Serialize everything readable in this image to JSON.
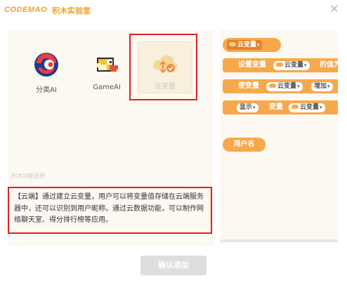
{
  "header": {
    "logo": "CODEMAO",
    "separator": "·",
    "title": "积木实验室",
    "close_icon": "close-icon"
  },
  "extensions": [
    {
      "label": "分类AI",
      "icon": "ai-classifier-icon"
    },
    {
      "label": "GameAI",
      "icon": "flappy-bird-icon"
    },
    {
      "label": "云变量",
      "icon": "cloud-variable-icon",
      "selected": true
    }
  ],
  "panel_hint": "积木功能选择",
  "description": "【云端】通过建立云变量，用户可以将变量值存储在云端服务器中，还可以识别到用户昵称。通过云数据功能，可以制作网络聊天室、得分排行榜等应用。",
  "blocks": {
    "cloud_var": "云变量",
    "set_label": "设置变量",
    "set_value": "的值为",
    "use_label": "使变量",
    "increase": "增加",
    "show": "显示",
    "variable_label": "变量",
    "username": "用户名"
  },
  "footer": {
    "confirm": "确认添加"
  },
  "colors": {
    "brand": "#f0a12a",
    "block": "#f7a84b",
    "highlight_border": "#e02020",
    "button_disabled": "#dedede"
  }
}
